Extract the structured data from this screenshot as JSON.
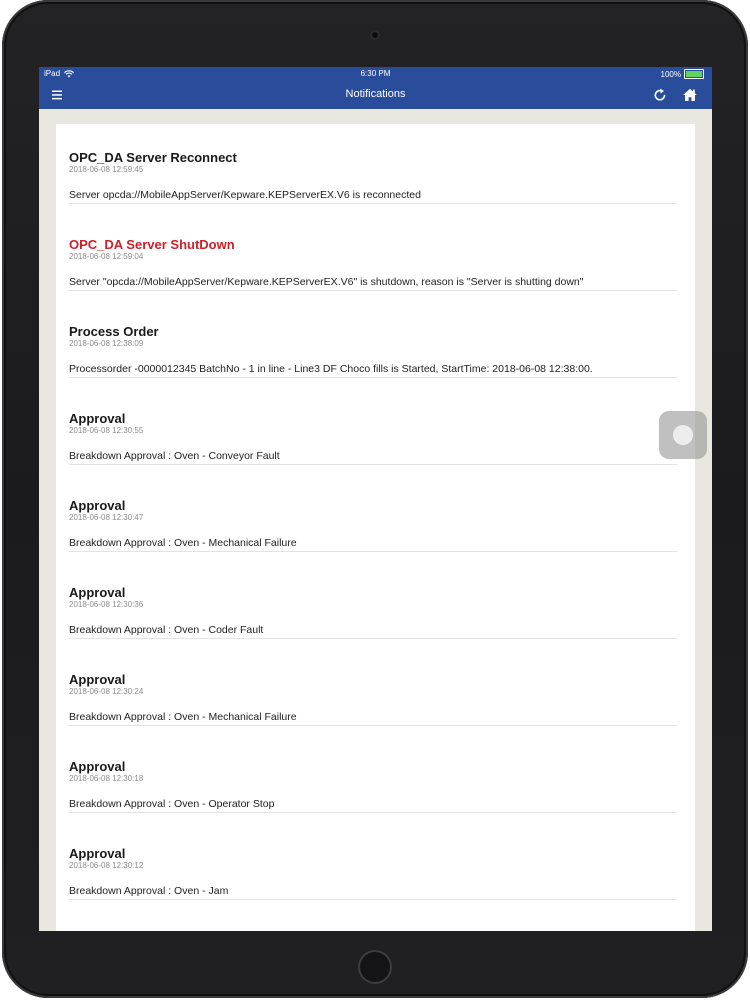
{
  "status_bar": {
    "device": "iPad",
    "time": "6:30 PM",
    "battery": "100%",
    "battery_level": 1.0
  },
  "nav": {
    "title": "Notifications"
  },
  "notifications": [
    {
      "title": "OPC_DA Server Reconnect",
      "time": "2018-06-08 12:59:45",
      "body": "Server opcda://MobileAppServer/Kepware.KEPServerEX.V6 is reconnected",
      "alert": false
    },
    {
      "title": "OPC_DA Server ShutDown",
      "time": "2018-06-08 12:59:04",
      "body": "Server \"opcda://MobileAppServer/Kepware.KEPServerEX.V6\" is shutdown, reason is \"Server is shutting down\"",
      "alert": true
    },
    {
      "title": "Process Order",
      "time": "2018-06-08 12:38:09",
      "body": "Processorder -0000012345 BatchNo - 1 in line - Line3 DF Choco fills is Started, StartTime: 2018-06-08 12:38:00.",
      "alert": false
    },
    {
      "title": "Approval",
      "time": "2018-06-08 12:30:55",
      "body": "Breakdown Approval : Oven - Conveyor Fault",
      "alert": false
    },
    {
      "title": "Approval",
      "time": "2018-06-08 12:30:47",
      "body": "Breakdown Approval : Oven - Mechanical Failure",
      "alert": false
    },
    {
      "title": "Approval",
      "time": "2018-06-08 12:30:36",
      "body": "Breakdown Approval : Oven - Coder Fault",
      "alert": false
    },
    {
      "title": "Approval",
      "time": "2018-06-08 12:30:24",
      "body": "Breakdown Approval : Oven - Mechanical Failure",
      "alert": false
    },
    {
      "title": "Approval",
      "time": "2018-06-08 12:30:18",
      "body": "Breakdown Approval : Oven - Operator Stop",
      "alert": false
    },
    {
      "title": "Approval",
      "time": "2018-06-08 12:30:12",
      "body": "Breakdown Approval : Oven - Jam",
      "alert": false
    }
  ],
  "colors": {
    "nav_bar": "#294d9a",
    "alert_title": "#c8232a",
    "background": "#e9e8e0",
    "battery": "#5fd35f"
  },
  "icons": {
    "menu": "hamburger-menu-icon",
    "refresh": "refresh-icon",
    "home": "home-icon",
    "wifi": "wifi-icon",
    "battery": "battery-icon"
  }
}
